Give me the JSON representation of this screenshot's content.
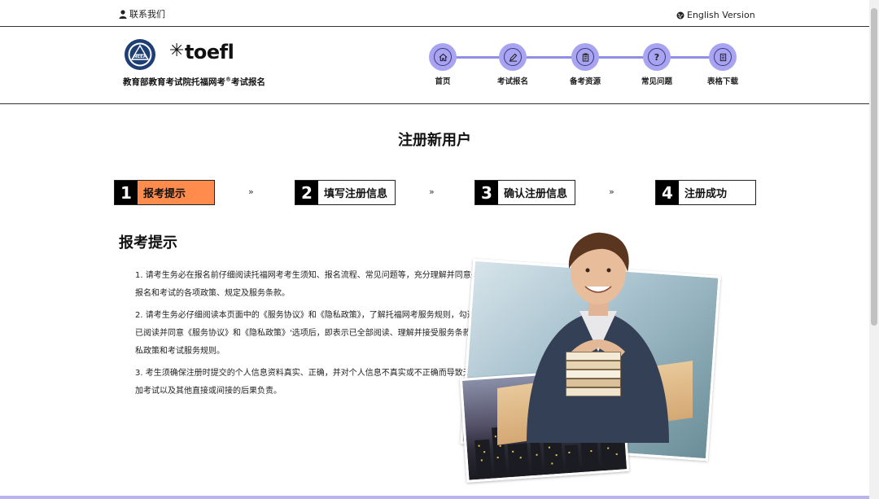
{
  "topbar": {
    "contact": "联系我们",
    "english": "English Version"
  },
  "header": {
    "nea_logo_text": "NEEA",
    "toefl_brand": "toefl",
    "title_prefix": "教育部教育考试院托福网考",
    "title_reg": "®",
    "title_suffix": "考试报名"
  },
  "nav": [
    {
      "label": "首页",
      "icon": "home-icon"
    },
    {
      "label": "考试报名",
      "icon": "edit-icon"
    },
    {
      "label": "备考资源",
      "icon": "clipboard-icon"
    },
    {
      "label": "常见问题",
      "icon": "question-icon",
      "glyph": "?"
    },
    {
      "label": "表格下载",
      "icon": "document-icon"
    }
  ],
  "page_title": "注册新用户",
  "steps": [
    {
      "num": "1",
      "label": "报考提示"
    },
    {
      "num": "2",
      "label": "填写注册信息"
    },
    {
      "num": "3",
      "label": "确认注册信息"
    },
    {
      "num": "4",
      "label": "注册成功"
    }
  ],
  "chevron": "»",
  "section_title": "报考提示",
  "notices": [
    "1. 请考生务必在报名前仔细阅读托福网考考生须知、报名流程、常见问题等，充分理解并同意关于报名和考试的各项政策、规定及服务条款。",
    "2. 请考生务必仔细阅读本页面中的《服务协议》和《隐私政策》，了解托福网考服务规则，勾选'我已阅读并同意《服务协议》和《隐私政策》'选项后，即表示已全部阅读、理解并接受服务条款、隐私政策和考试服务规则。",
    "3. 考生须确保注册时提交的个人信息资料真实、正确，并对个人信息不真实或不正确而导致无法参加考试以及其他直接或间接的后果负责。"
  ],
  "colors": {
    "accent": "#ff8c4c",
    "nav": "#a9a4f2",
    "nav_line": "#8f8fe6",
    "footer": "#b9b4f0"
  }
}
